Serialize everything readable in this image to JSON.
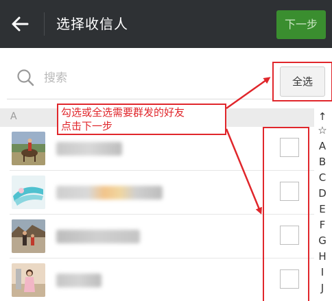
{
  "header": {
    "title": "选择收信人",
    "next_label": "下一步"
  },
  "search": {
    "placeholder": "搜索",
    "select_all_label": "全选"
  },
  "section": {
    "letter": "A"
  },
  "annotation": {
    "line1": "勾选或全选需要群发的好友",
    "line2": "点击下一步"
  },
  "contacts": [
    {
      "checked": false
    },
    {
      "checked": false
    },
    {
      "checked": false
    },
    {
      "checked": false
    }
  ],
  "index": [
    "↑",
    "☆",
    "A",
    "B",
    "C",
    "D",
    "E",
    "F",
    "G",
    "H",
    "I",
    "J"
  ],
  "colors": {
    "topbar": "#2e3134",
    "next_button": "#3a8e2f",
    "annotation_red": "#e0262b",
    "section_bg": "#ebebeb"
  },
  "icons": {
    "back": "back-arrow-icon",
    "search": "search-icon"
  }
}
